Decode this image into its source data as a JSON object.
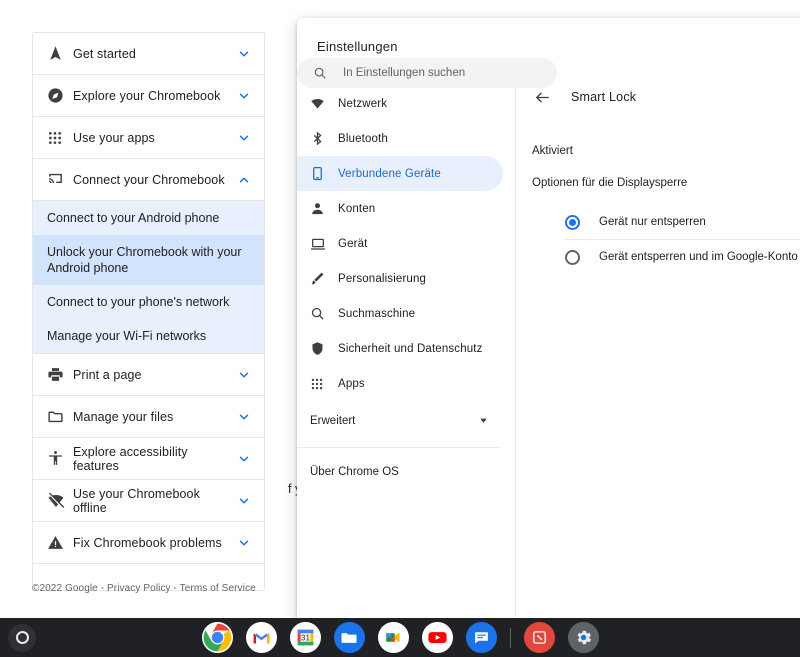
{
  "help_page": {
    "sections": [
      {
        "label": "Get started",
        "icon": "navigation-arrow-icon",
        "expanded": false
      },
      {
        "label": "Explore your Chromebook",
        "icon": "compass-icon",
        "expanded": false
      },
      {
        "label": "Use your apps",
        "icon": "apps-grid-icon",
        "expanded": false
      },
      {
        "label": "Connect your Chromebook",
        "icon": "cast-icon",
        "expanded": true
      }
    ],
    "sub_items": [
      {
        "label": "Connect to your Android phone",
        "active": false
      },
      {
        "label": "Unlock your Chromebook with your Android phone",
        "active": true
      },
      {
        "label": "Connect to your phone's network",
        "active": false
      },
      {
        "label": "Manage your Wi-Fi networks",
        "active": false
      }
    ],
    "sections_after": [
      {
        "label": "Print a page",
        "icon": "printer-icon",
        "expanded": false
      },
      {
        "label": "Manage your files",
        "icon": "folder-icon",
        "expanded": false
      },
      {
        "label": "Explore accessibility features",
        "icon": "accessibility-icon",
        "expanded": false
      },
      {
        "label": "Use your Chromebook offline",
        "icon": "wifi-off-icon",
        "expanded": false
      },
      {
        "label": "Fix Chromebook problems",
        "icon": "warning-triangle-icon",
        "expanded": false
      }
    ],
    "footer": "©2022 Google - Privacy Policy - Terms of Service",
    "background_fragment": "f y"
  },
  "settings": {
    "title": "Einstellungen",
    "search": {
      "placeholder": "In Einstellungen suchen",
      "value": "",
      "icon": "search-icon"
    },
    "nav": [
      {
        "label": "Netzwerk",
        "icon": "wifi-icon",
        "selected": false
      },
      {
        "label": "Bluetooth",
        "icon": "bluetooth-icon",
        "selected": false
      },
      {
        "label": "Verbundene Geräte",
        "icon": "smartphone-icon",
        "selected": true
      },
      {
        "label": "Konten",
        "icon": "person-icon",
        "selected": false
      },
      {
        "label": "Gerät",
        "icon": "laptop-icon",
        "selected": false
      },
      {
        "label": "Personalisierung",
        "icon": "brush-icon",
        "selected": false
      },
      {
        "label": "Suchmaschine",
        "icon": "search-icon",
        "selected": false
      },
      {
        "label": "Sicherheit und Datenschutz",
        "icon": "shield-icon",
        "selected": false
      },
      {
        "label": "Apps",
        "icon": "apps-grid-icon",
        "selected": false
      }
    ],
    "advanced": {
      "label": "Erweitert",
      "icon": "chevron-down-icon"
    },
    "about": {
      "label": "Über Chrome OS"
    },
    "page": {
      "back_icon": "back-arrow-icon",
      "title": "Smart Lock",
      "toggle": {
        "label": "Aktiviert",
        "state": "on"
      },
      "options_title": "Optionen für die Displaysperre",
      "options": [
        {
          "label": "Gerät nur entsperren",
          "selected": true
        },
        {
          "label": "Gerät entsperren und im Google-Konto anmelden",
          "selected": false
        }
      ]
    }
  },
  "shelf": {
    "launcher": {
      "icon": "launcher-circle-icon"
    },
    "apps": [
      {
        "name": "chrome-icon",
        "running": true
      },
      {
        "name": "gmail-icon",
        "running": true
      },
      {
        "name": "calendar-icon",
        "running": true
      },
      {
        "name": "files-icon",
        "running": true
      },
      {
        "name": "meet-icon",
        "running": true
      },
      {
        "name": "youtube-icon",
        "running": true
      },
      {
        "name": "chat-icon",
        "running": true
      },
      {
        "name": "separator",
        "running": false
      },
      {
        "name": "red-app-icon",
        "running": true
      },
      {
        "name": "settings-gear-icon",
        "running": true
      }
    ]
  },
  "colors": {
    "accent": "#1a73e8",
    "accent_light": "#8ab4f8",
    "selected_nav_bg": "#e8f0fe",
    "sub_active_bg": "#d2e3fc",
    "shelf_bg": "#202124"
  }
}
